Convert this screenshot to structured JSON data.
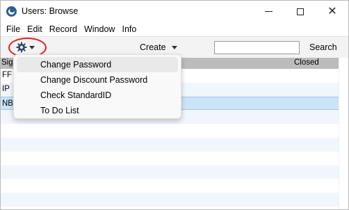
{
  "window": {
    "title": "Users: Browse",
    "controls": {
      "minimize": "minimize",
      "maximize": "maximize",
      "close": "✕"
    }
  },
  "menubar": {
    "items": [
      "File",
      "Edit",
      "Record",
      "Window",
      "Info"
    ]
  },
  "toolbar": {
    "create_label": "Create",
    "search_value": "",
    "search_label": "Search"
  },
  "table": {
    "columns": [
      "Sign",
      "Closed"
    ],
    "rows": [
      {
        "sign": "FF",
        "closed": ""
      },
      {
        "sign": "IP",
        "closed": ""
      },
      {
        "sign": "NB",
        "closed": "",
        "selected": true
      }
    ]
  },
  "operations_menu": {
    "items": [
      "Change Password",
      "Change Discount Password",
      "Check StandardID",
      "To Do List"
    ]
  },
  "colors": {
    "accent_ellipse": "#e0201f",
    "selected_row": "#cce4f7",
    "header": "#bcbcbc"
  }
}
